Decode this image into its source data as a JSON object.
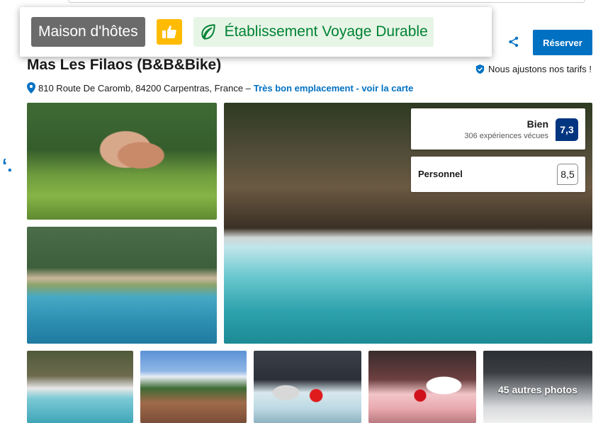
{
  "badges": {
    "property_type": "Maison d'hôtes",
    "sustainable": "Établissement Voyage Durable"
  },
  "actions": {
    "reserve_label": "Réserver"
  },
  "property": {
    "title": "Mas Les Filaos (B&B&Bike)",
    "price_match": "Nous ajustons nos tarifs !",
    "address": "810 Route De Caromb, 84200 Carpentras, France –",
    "location_link": "Très bon emplacement - voir la carte"
  },
  "rating": {
    "word": "Bien",
    "count": "306 expériences vécues",
    "score": "7,3"
  },
  "staff_rating": {
    "label": "Personnel",
    "score": "8,5"
  },
  "gallery": {
    "more_photos": "45 autres photos"
  },
  "colors": {
    "brand_blue": "#0071c2",
    "dark_blue": "#003580",
    "badge_yellow": "#febb02",
    "sustain_green": "#008234"
  }
}
